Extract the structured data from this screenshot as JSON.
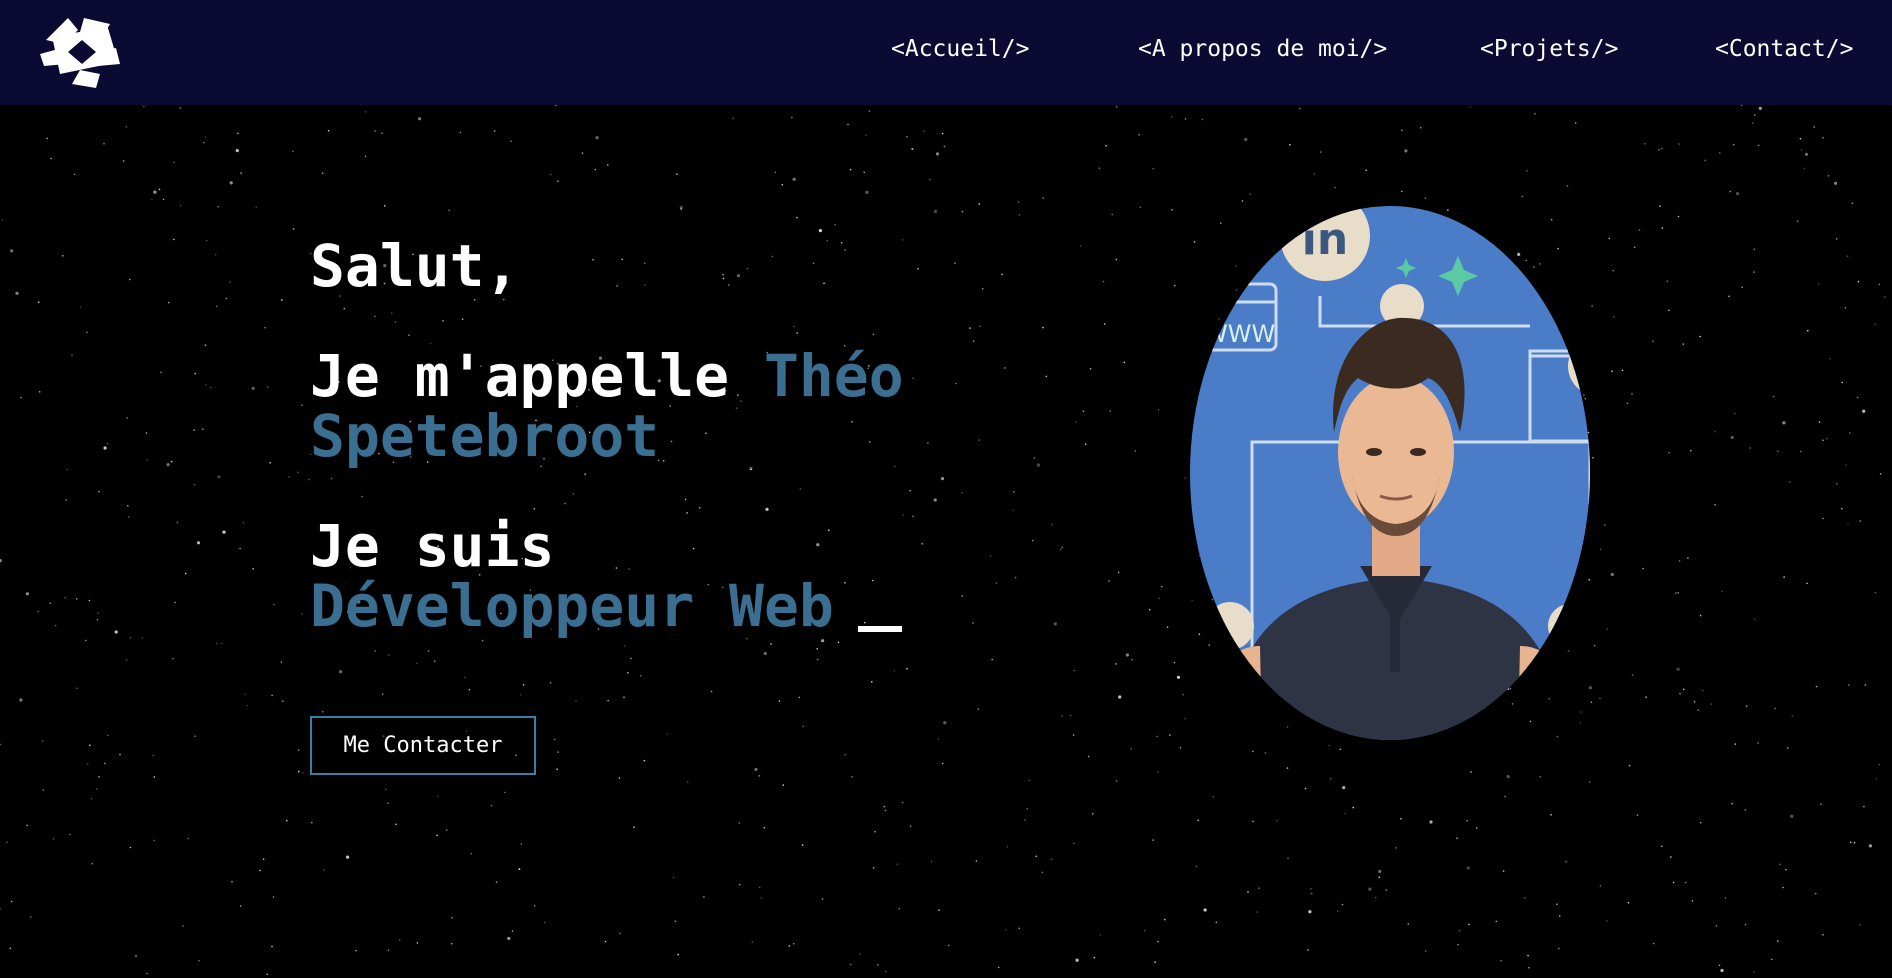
{
  "nav": {
    "logo": "logo-icon",
    "links": [
      {
        "label": "<Accueil/>"
      },
      {
        "label": "<A propos de moi/>"
      },
      {
        "label": "<Projets/>"
      },
      {
        "label": "<Contact/>"
      }
    ]
  },
  "hero": {
    "greeting": "Salut,",
    "intro_prefix": "Je m'appelle",
    "first_name": "Théo",
    "last_name": "Spetebroot",
    "role_prefix": "Je suis",
    "role": "Développeur Web",
    "cta_label": "Me Contacter"
  },
  "portrait": {
    "icon": "profile-photo",
    "backdrop_texts": [
      "in",
      "WWW"
    ]
  },
  "colors": {
    "navbar": "#0a0a33",
    "background": "#000000",
    "accent": "#3a6f91",
    "button_border": "#3a7ea3",
    "text": "#ffffff",
    "photo_backdrop": "#4a7cc8"
  }
}
